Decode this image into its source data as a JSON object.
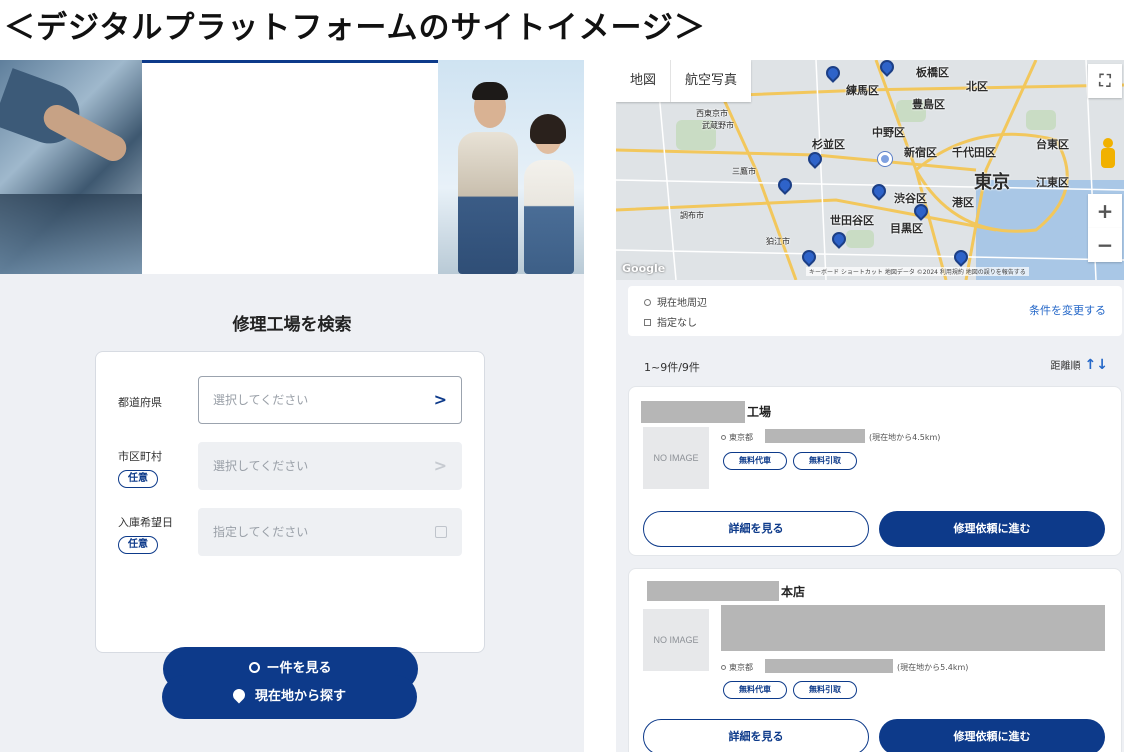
{
  "page_title": "＜デジタルプラットフォームのサイトイメージ＞",
  "search_panel": {
    "title": "修理工場を検索",
    "fields": [
      {
        "label": "都道府県",
        "placeholder": "選択してください"
      },
      {
        "label": "市区町村",
        "optional": "任意",
        "placeholder": "選択してください"
      },
      {
        "label": "入庫希望日",
        "optional": "任意",
        "placeholder": "指定してください"
      }
    ],
    "search_button": "ー件を見る",
    "location_button": "現在地から探す"
  },
  "map": {
    "tabs": [
      "地図",
      "航空写真"
    ],
    "zoom_in": "+",
    "zoom_out": "−",
    "fullscreen": "⛶",
    "logo": "Google",
    "attribution": "キーボード ショートカット 地図データ ©2024 利用規約 地図の誤りを報告する",
    "place_labels": [
      "板橋区",
      "北区",
      "練馬区",
      "豊島区",
      "中野区",
      "杉並区",
      "新宿区",
      "千代田区",
      "台東区",
      "東京",
      "江東区",
      "渋谷区",
      "港区",
      "世田谷区",
      "目黒区",
      "西東京市",
      "武蔵野市",
      "三鷹市",
      "調布市",
      "狛江市"
    ]
  },
  "conditions": {
    "location": "現在地周辺",
    "date": "指定なし",
    "change_link": "条件を変更する"
  },
  "results": {
    "count": "1~9件/9件",
    "sort": "距離順",
    "sort_icon": "sort-arrows-icon"
  },
  "cards": [
    {
      "name_suffix": "工場",
      "no_image": "NO IMAGE",
      "address_prefix": "東京都",
      "distance": "(現在地から4.5km)",
      "tags": [
        "無料代車",
        "無料引取"
      ],
      "detail_button": "詳細を見る",
      "request_button": "修理依頼に進む"
    },
    {
      "name_suffix": "本店",
      "no_image": "NO IMAGE",
      "address_prefix": "東京都",
      "distance": "(現在地から5.4km)",
      "tags": [
        "無料代車",
        "無料引取"
      ],
      "detail_button": "詳細を見る",
      "request_button": "修理依頼に進む"
    }
  ],
  "colors": {
    "primary": "#0d3a8a",
    "link": "#2467c8",
    "panel_bg": "#eef0f4"
  }
}
